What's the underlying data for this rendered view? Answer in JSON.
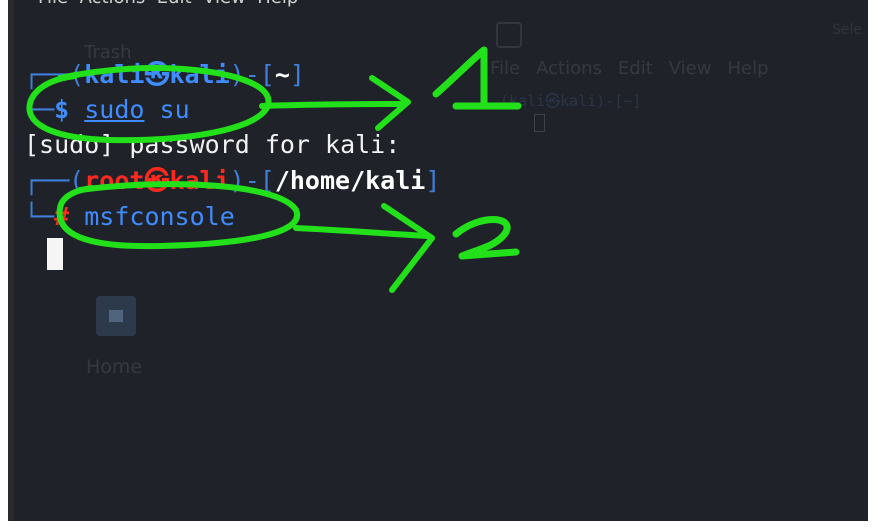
{
  "top_menu_partial": "File  Actions  Edit  View  Help",
  "background": {
    "desktop_trash_label": "Trash",
    "desktop_home_label": "Home",
    "second_terminal_menu": [
      "File",
      "Actions",
      "Edit",
      "View",
      "Help"
    ],
    "second_terminal_prompt": "(kali㉿kali)-[~]",
    "second_terminal_prompt2": "$",
    "corner_label": "Sele"
  },
  "terminal": {
    "line1": {
      "corner": "┌──",
      "open": "(",
      "user": "kali",
      "at": "㉿",
      "host": "kali",
      "close": ")-[",
      "path": "~",
      "end": "]"
    },
    "line2": {
      "corner": "└─",
      "sign": "$",
      "cmd1": "sudo",
      "cmd2": "su"
    },
    "line3": {
      "text": "[sudo] password for kali:"
    },
    "line4": {
      "corner": "┌──",
      "open": "(",
      "user": "root",
      "at": "㉿",
      "host": "kali",
      "close": ")-[",
      "path": "/home/kali",
      "end": "]"
    },
    "line5": {
      "corner": "└─",
      "sign": "#",
      "cmd": "msfconsole"
    }
  },
  "annotations": {
    "label1": "1",
    "label2": "2",
    "color": "#22e01a"
  }
}
